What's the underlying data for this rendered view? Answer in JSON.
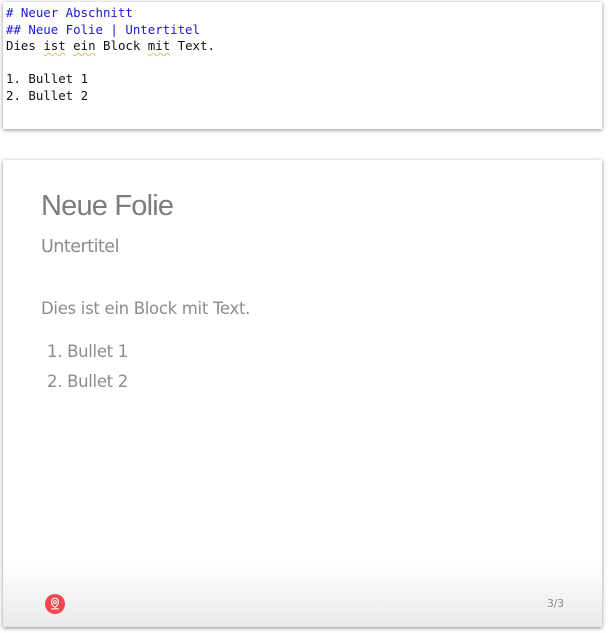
{
  "editor": {
    "lines": [
      {
        "text": "# Neuer Abschnitt",
        "kind": "heading"
      },
      {
        "text": "## Neue Folie | Untertitel",
        "kind": "heading"
      },
      {
        "parts": [
          "Dies ",
          "ist",
          " ",
          "ein",
          " Block ",
          "mit",
          " Text."
        ],
        "kind": "text"
      },
      {
        "text": "",
        "kind": "blank"
      },
      {
        "text": "1. Bullet 1",
        "kind": "text"
      },
      {
        "text": "2. Bullet 2",
        "kind": "text"
      }
    ]
  },
  "slide": {
    "title": "Neue Folie",
    "subtitle": "Untertitel",
    "body": "Dies ist ein Block mit Text.",
    "bullets": [
      "1. Bullet 1",
      "2. Bullet 2"
    ],
    "logo_icon": "brand-logo-icon",
    "logo_color": "#f0484c",
    "page_number": "3/3"
  },
  "colors": {
    "heading_code": "#1a1ad6",
    "slide_text": "#8c8c8c"
  }
}
